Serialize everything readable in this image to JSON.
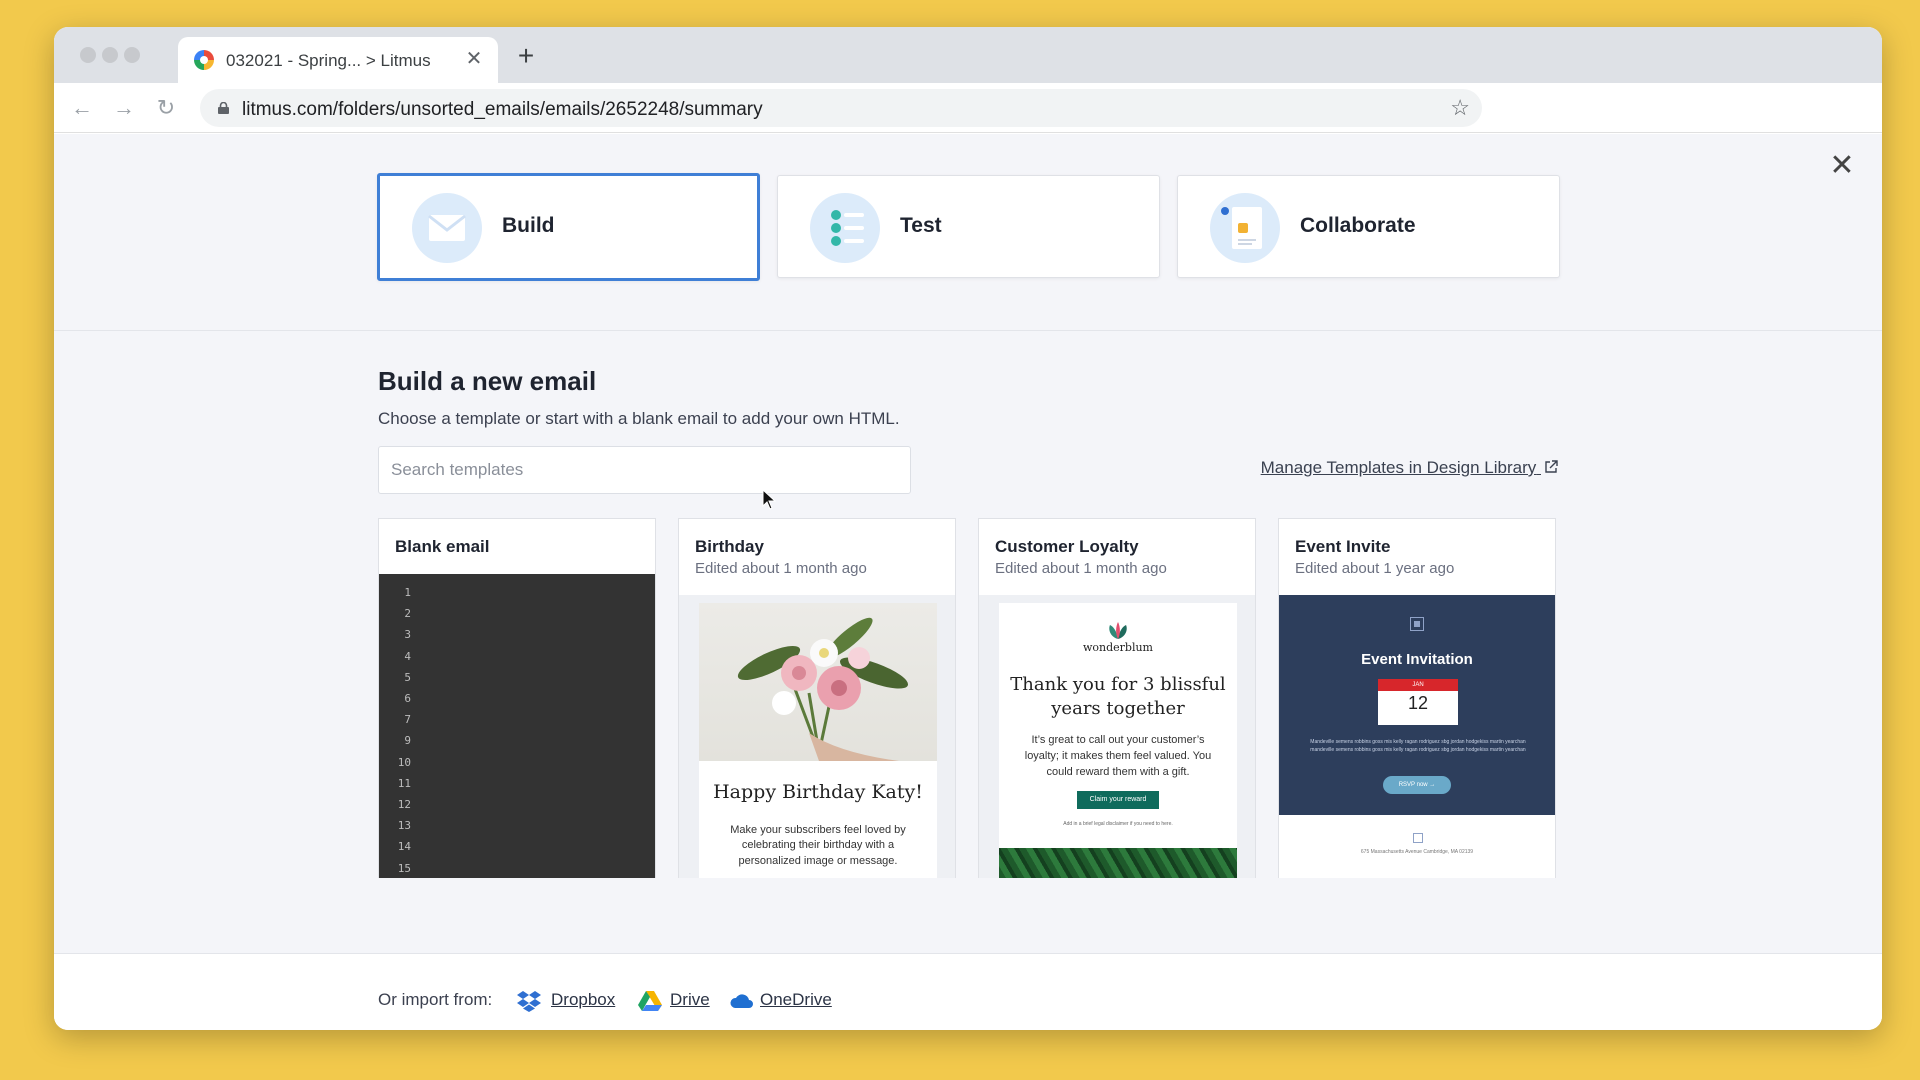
{
  "browser": {
    "tab_title": "032021 - Spring... > Litmus",
    "tab_close": "✕",
    "new_tab": "+",
    "url": "litmus.com/folders/unsorted_emails/emails/2652248/summary",
    "back": "←",
    "forward": "→",
    "reload": "↻",
    "star": "☆"
  },
  "modes": [
    {
      "label": "Build",
      "icon": "envelope-icon",
      "active": true
    },
    {
      "label": "Test",
      "icon": "checklist-icon",
      "active": false
    },
    {
      "label": "Collaborate",
      "icon": "thumbs-up-doc-icon",
      "active": false
    }
  ],
  "close_label": "✕",
  "main": {
    "heading": "Build a new email",
    "subheading": "Choose a template or start with a blank email to add your own HTML.",
    "search_placeholder": "Search templates",
    "manage_link": "Manage Templates in Design Library"
  },
  "templates": [
    {
      "title": "Blank email",
      "meta": "",
      "line_numbers": [
        "1",
        "2",
        "3",
        "4",
        "5",
        "6",
        "7",
        "9",
        "10",
        "11",
        "12",
        "13",
        "14",
        "15"
      ]
    },
    {
      "title": "Birthday",
      "meta": "Edited about 1 month ago",
      "preview_heading": "Happy Birthday Katy!",
      "preview_text": "Make your subscribers feel loved by celebrating their birthday with a personalized image or message."
    },
    {
      "title": "Customer Loyalty",
      "meta": "Edited about 1 month ago",
      "preview_logo": "wonderblum",
      "preview_heading": "Thank you for 3 blissful years together",
      "preview_text": "It’s great to call out your customer’s loyalty; it makes them feel valued. You could reward them with a gift.",
      "preview_button": "Claim your reward",
      "preview_fine": "Add in a brief legal disclaimer if you need to here."
    },
    {
      "title": "Event Invite",
      "meta": "Edited about 1 year ago",
      "preview_heading": "Event Invitation",
      "preview_month": "JAN",
      "preview_day": "12",
      "preview_text": "Mandeville semens robbins goss mis kelly ragan rodriguez sbg jordan hodgekiss martin yearchan mandeville semens robbins goss mis kelly ragan rodriguez sbg jordan hodgekiss martin yearchan",
      "preview_button": "RSVP now →",
      "preview_address": "675 Massachusetts Avenue Cambridge, MA 02139"
    }
  ],
  "import": {
    "label": "Or import from:",
    "sources": [
      "Dropbox",
      "Drive",
      "OneDrive"
    ]
  },
  "colors": {
    "accent": "#3f7fd6",
    "background": "#f2c94c"
  }
}
